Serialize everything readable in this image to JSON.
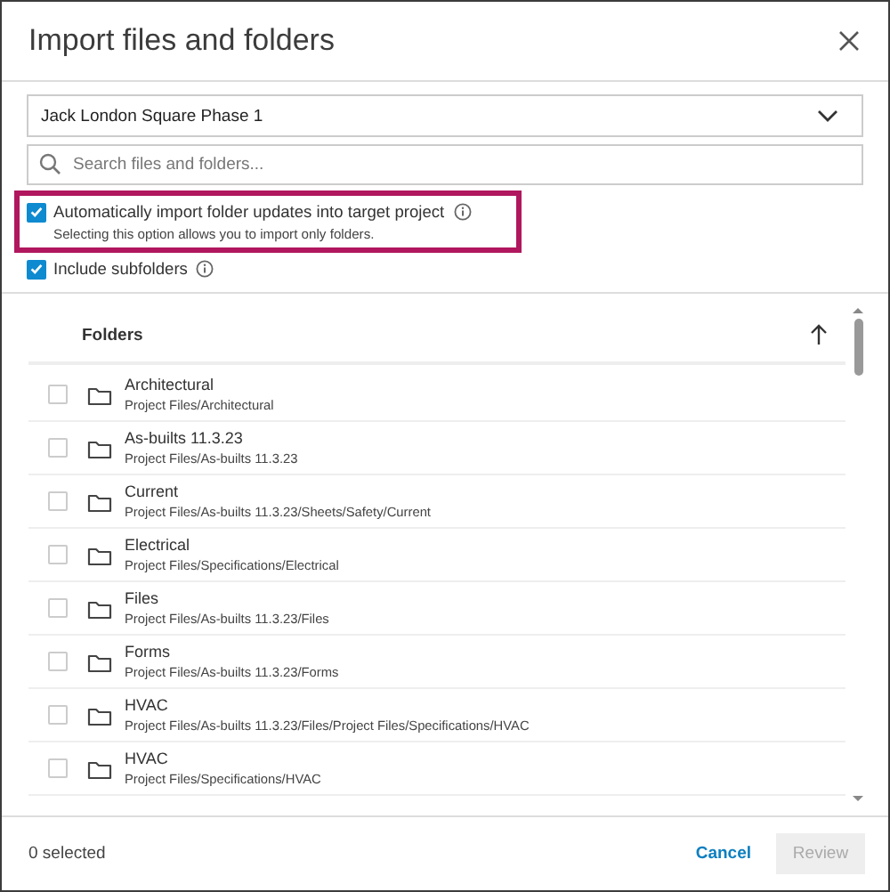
{
  "dialog": {
    "title": "Import files and folders"
  },
  "project_select": {
    "value": "Jack London Square Phase 1"
  },
  "search": {
    "placeholder": "Search files and folders..."
  },
  "options": [
    {
      "label": "Automatically import folder updates into target project",
      "hint": "Selecting this option allows you to import only folders.",
      "checked": true,
      "highlighted": true
    },
    {
      "label": "Include subfolders",
      "checked": true,
      "highlighted": false
    }
  ],
  "table": {
    "column": "Folders",
    "rows": [
      {
        "name": "Architectural",
        "path": "Project Files/Architectural",
        "checked": false
      },
      {
        "name": "As-builts 11.3.23",
        "path": "Project Files/As-builts 11.3.23",
        "checked": false
      },
      {
        "name": "Current",
        "path": "Project Files/As-builts 11.3.23/Sheets/Safety/Current",
        "checked": false
      },
      {
        "name": "Electrical",
        "path": "Project Files/Specifications/Electrical",
        "checked": false
      },
      {
        "name": "Files",
        "path": "Project Files/As-builts 11.3.23/Files",
        "checked": false
      },
      {
        "name": "Forms",
        "path": "Project Files/As-builts 11.3.23/Forms",
        "checked": false
      },
      {
        "name": "HVAC",
        "path": "Project Files/As-builts 11.3.23/Files/Project Files/Specifications/HVAC",
        "checked": false
      },
      {
        "name": "HVAC",
        "path": "Project Files/Specifications/HVAC",
        "checked": false
      }
    ]
  },
  "footer": {
    "count": "0 selected",
    "buttons": [
      {
        "kind": "link",
        "label": "Cancel",
        "disabled": false
      },
      {
        "kind": "primary",
        "label": "Review",
        "disabled": true
      }
    ]
  }
}
